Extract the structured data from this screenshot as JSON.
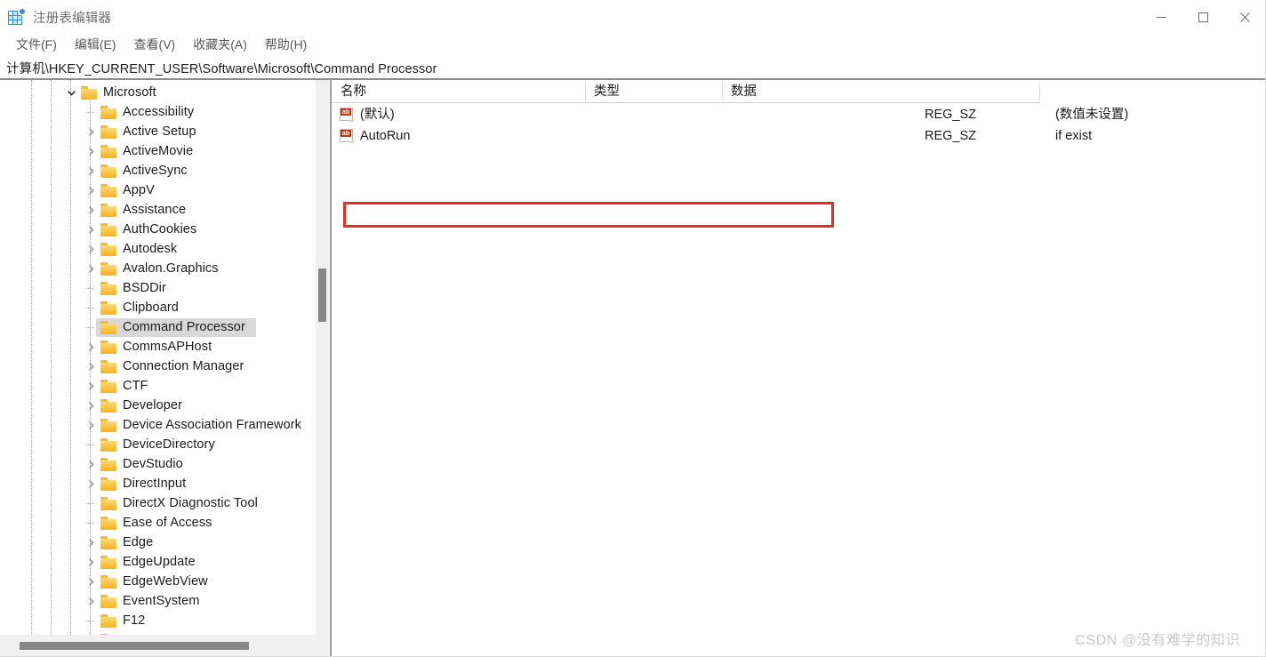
{
  "window": {
    "title": "注册表编辑器",
    "app_icon": "registry-editor-icon",
    "controls": {
      "minimize": "minimize-icon",
      "maximize": "maximize-icon",
      "close": "close-icon"
    }
  },
  "menubar": {
    "items": [
      {
        "label": "文件(F)"
      },
      {
        "label": "编辑(E)"
      },
      {
        "label": "查看(V)"
      },
      {
        "label": "收藏夹(A)"
      },
      {
        "label": "帮助(H)"
      }
    ]
  },
  "addressbar": {
    "path": "计算机\\HKEY_CURRENT_USER\\Software\\Microsoft\\Command Processor"
  },
  "tree": {
    "items": [
      {
        "label": "Microsoft",
        "depth": 0,
        "state": "expanded",
        "selected": false
      },
      {
        "label": "Accessibility",
        "depth": 1,
        "state": "leaf",
        "selected": false
      },
      {
        "label": "Active Setup",
        "depth": 1,
        "state": "collapsed",
        "selected": false
      },
      {
        "label": "ActiveMovie",
        "depth": 1,
        "state": "collapsed",
        "selected": false
      },
      {
        "label": "ActiveSync",
        "depth": 1,
        "state": "collapsed",
        "selected": false
      },
      {
        "label": "AppV",
        "depth": 1,
        "state": "collapsed",
        "selected": false
      },
      {
        "label": "Assistance",
        "depth": 1,
        "state": "collapsed",
        "selected": false
      },
      {
        "label": "AuthCookies",
        "depth": 1,
        "state": "collapsed",
        "selected": false
      },
      {
        "label": "Autodesk",
        "depth": 1,
        "state": "collapsed",
        "selected": false
      },
      {
        "label": "Avalon.Graphics",
        "depth": 1,
        "state": "collapsed",
        "selected": false
      },
      {
        "label": "BSDDir",
        "depth": 1,
        "state": "leaf",
        "selected": false
      },
      {
        "label": "Clipboard",
        "depth": 1,
        "state": "leaf",
        "selected": false
      },
      {
        "label": "Command Processor",
        "depth": 1,
        "state": "leaf",
        "selected": true
      },
      {
        "label": "CommsAPHost",
        "depth": 1,
        "state": "collapsed",
        "selected": false
      },
      {
        "label": "Connection Manager",
        "depth": 1,
        "state": "collapsed",
        "selected": false
      },
      {
        "label": "CTF",
        "depth": 1,
        "state": "collapsed",
        "selected": false
      },
      {
        "label": "Developer",
        "depth": 1,
        "state": "collapsed",
        "selected": false
      },
      {
        "label": "Device Association Framework",
        "depth": 1,
        "state": "collapsed",
        "selected": false
      },
      {
        "label": "DeviceDirectory",
        "depth": 1,
        "state": "leaf",
        "selected": false
      },
      {
        "label": "DevStudio",
        "depth": 1,
        "state": "collapsed",
        "selected": false
      },
      {
        "label": "DirectInput",
        "depth": 1,
        "state": "collapsed",
        "selected": false
      },
      {
        "label": "DirectX Diagnostic Tool",
        "depth": 1,
        "state": "leaf",
        "selected": false
      },
      {
        "label": "Ease of Access",
        "depth": 1,
        "state": "leaf",
        "selected": false
      },
      {
        "label": "Edge",
        "depth": 1,
        "state": "collapsed",
        "selected": false
      },
      {
        "label": "EdgeUpdate",
        "depth": 1,
        "state": "collapsed",
        "selected": false
      },
      {
        "label": "EdgeWebView",
        "depth": 1,
        "state": "collapsed",
        "selected": false
      },
      {
        "label": "EventSystem",
        "depth": 1,
        "state": "collapsed",
        "selected": false
      },
      {
        "label": "F12",
        "depth": 1,
        "state": "leaf",
        "selected": false
      }
    ]
  },
  "value_list": {
    "columns": [
      {
        "label": "名称"
      },
      {
        "label": "类型"
      },
      {
        "label": "数据"
      }
    ],
    "rows": [
      {
        "icon": "string-value-icon",
        "name": "(默认)",
        "type": "REG_SZ",
        "data": "(数值未设置)",
        "highlighted": false
      },
      {
        "icon": "string-value-icon",
        "name": "AutoRun",
        "type": "REG_SZ",
        "data": "if exist",
        "highlighted": true
      }
    ]
  },
  "annotation": {
    "color": "#ee2b23",
    "target_row": "AutoRun"
  },
  "watermark": {
    "text": "CSDN @没有难学的知识"
  }
}
